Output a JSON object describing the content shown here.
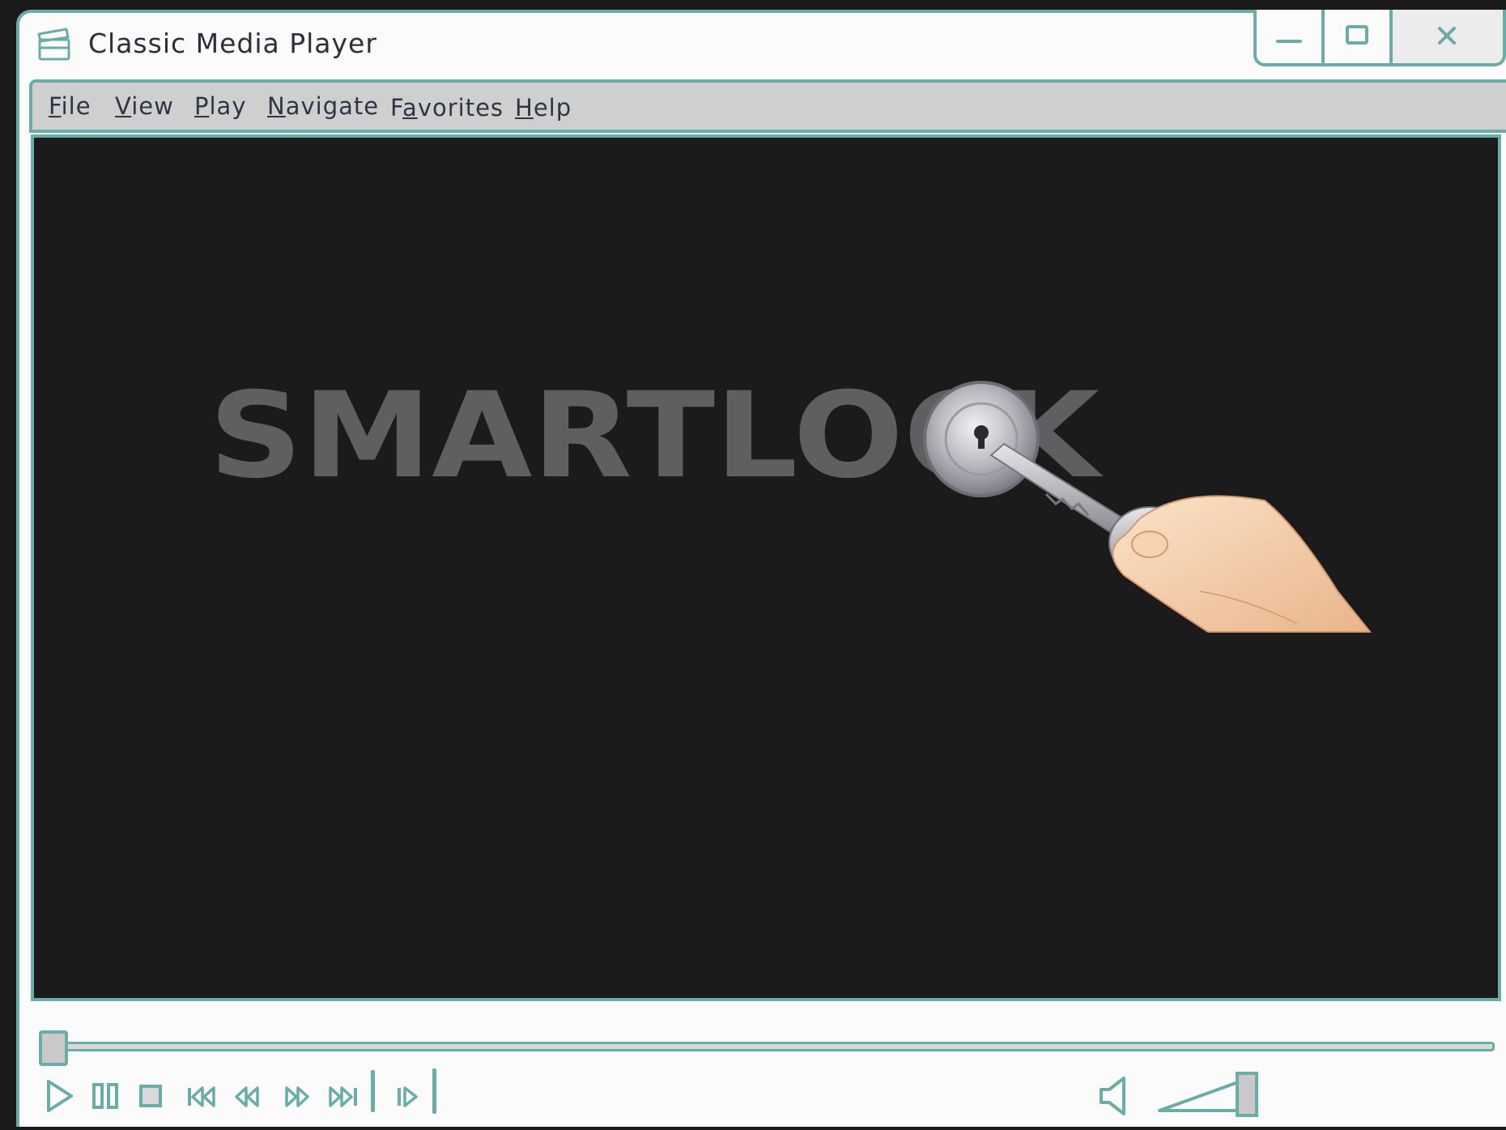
{
  "window": {
    "title": "Classic Media Player",
    "controls": [
      "minimize",
      "maximize",
      "close"
    ]
  },
  "menu": [
    {
      "label": "File",
      "shortcut": "F"
    },
    {
      "label": "View",
      "shortcut": "V"
    },
    {
      "label": "Play",
      "shortcut": "P"
    },
    {
      "label": "Navigate",
      "shortcut": "N"
    },
    {
      "label": "Favorites",
      "shortcut": "a"
    },
    {
      "label": "Help",
      "shortcut": "H"
    }
  ],
  "video": {
    "logo_text": "SMARTLOCK"
  },
  "playback": {
    "progress": 0.0,
    "volume": 1.0
  },
  "buttons": [
    "play-icon",
    "pause-icon",
    "stop-icon",
    "skip-back-icon",
    "rewind-icon",
    "fast-forward-icon",
    "skip-forward-icon",
    "step-frame-icon",
    "volume-icon"
  ],
  "colors": {
    "accent": "#6aaca6",
    "background": "#fbfbfb",
    "menubar": "#cfcfcf",
    "video_bg": "#1b1b1b",
    "text": "#2e3646"
  }
}
